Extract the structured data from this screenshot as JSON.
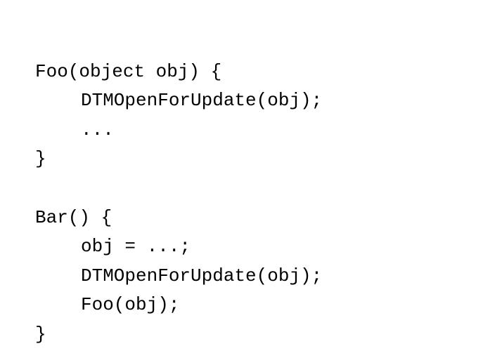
{
  "code": {
    "foo_signature": "Foo(object obj) {",
    "foo_line1": "DTMOpenForUpdate(obj);",
    "foo_line2": "...",
    "foo_close": "}",
    "bar_signature": "Bar() {",
    "bar_line1": "obj = ...;",
    "bar_line2": "DTMOpenForUpdate(obj);",
    "bar_line3": "Foo(obj);",
    "bar_close": "}"
  }
}
